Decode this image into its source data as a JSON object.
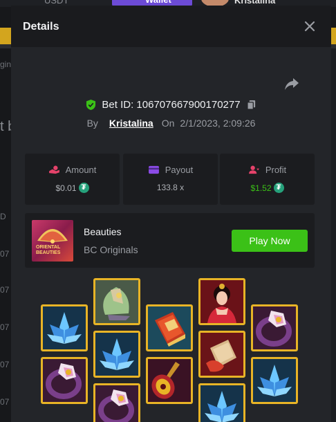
{
  "background": {
    "currency": "USDT",
    "wallet_label": "Wallet",
    "username": "Kristalina",
    "left_texts": [
      "gin",
      "t b",
      "D",
      "07",
      "07",
      "07",
      "07",
      "07"
    ]
  },
  "modal": {
    "title": "Details",
    "bet": {
      "label": "Bet ID:",
      "id": "106707667900170277",
      "by_label": "By",
      "username": "Kristalina",
      "on_label": "On",
      "date": "2/1/2023, 2:09:26"
    },
    "stats": [
      {
        "label": "Amount",
        "value": "$0.01",
        "icon": "amount-icon",
        "color": "#aeb1b6",
        "coin": true
      },
      {
        "label": "Payout",
        "value": "133.8 x",
        "icon": "payout-icon",
        "color": "#aeb1b6",
        "coin": false
      },
      {
        "label": "Profit",
        "value": "$1.52",
        "icon": "profit-icon",
        "color": "#3bc117",
        "coin": true
      }
    ],
    "game": {
      "name": "Beauties",
      "provider": "BC Originals",
      "thumb_text": "ORIENTAL BEAUTIES",
      "play_label": "Play Now"
    },
    "symbols": [
      {
        "id": "lotus"
      },
      {
        "id": "fan"
      },
      {
        "id": "book"
      },
      {
        "id": "lady"
      },
      {
        "id": "ring"
      },
      {
        "id": "ring"
      },
      {
        "id": "lotus"
      },
      {
        "id": "lute"
      },
      {
        "id": "scroll"
      },
      {
        "id": "lotus"
      },
      {
        "id": "ring"
      },
      {
        "id": "lotus"
      }
    ]
  },
  "colors": {
    "accent_green": "#3bc117",
    "tile_border": "#e8b426",
    "shield_green": "#3bc117",
    "tether_green": "#26a17b"
  }
}
